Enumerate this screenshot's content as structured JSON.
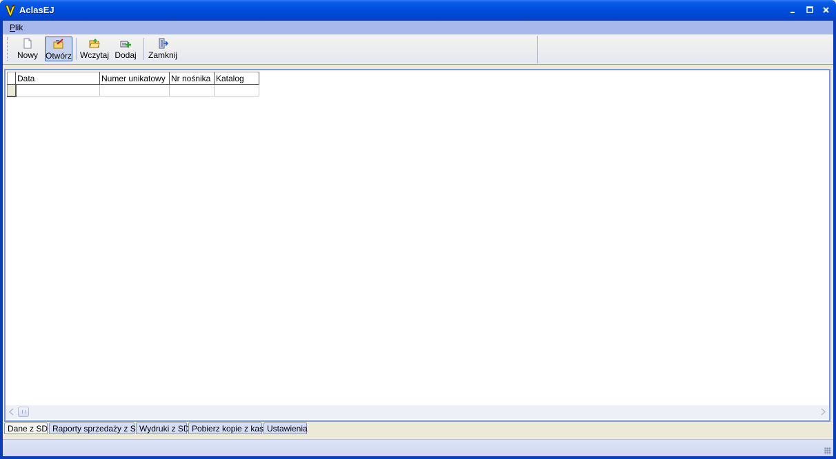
{
  "window": {
    "title": "AclasEJ",
    "controls": {
      "minimize": "_",
      "maximize": "□",
      "close": "×"
    }
  },
  "menu": {
    "items": [
      {
        "underlined": "P",
        "rest": "lik"
      }
    ]
  },
  "toolbar": {
    "buttons": [
      {
        "label": "Nowy",
        "icon": "new-document-icon"
      },
      {
        "label": "Otwórz",
        "icon": "open-icon",
        "pressed": true
      },
      {
        "label": "Wczytaj",
        "icon": "folder-load-icon"
      },
      {
        "label": "Dodaj",
        "icon": "add-icon"
      },
      {
        "label": "Zamknij",
        "icon": "exit-door-icon"
      }
    ]
  },
  "grid": {
    "columns": [
      "Data",
      "Numer unikatowy",
      "Nr nośnika",
      "Katalog"
    ],
    "rows": [
      [
        "",
        "",
        "",
        ""
      ]
    ]
  },
  "tabs": {
    "items": [
      {
        "label": "Dane z SD",
        "active": true
      },
      {
        "label": "Raporty sprzedaży z SD",
        "active": false
      },
      {
        "label": "Wydruki z SD",
        "active": false
      },
      {
        "label": "Pobierz kopie z kasy",
        "active": false
      },
      {
        "label": "Ustawienia",
        "active": false
      }
    ]
  },
  "statusbar": {
    "text": ""
  },
  "colors": {
    "titlebar": "#0050E0",
    "menubar": "#A8B8EC",
    "panel_border": "#7A96DF"
  }
}
